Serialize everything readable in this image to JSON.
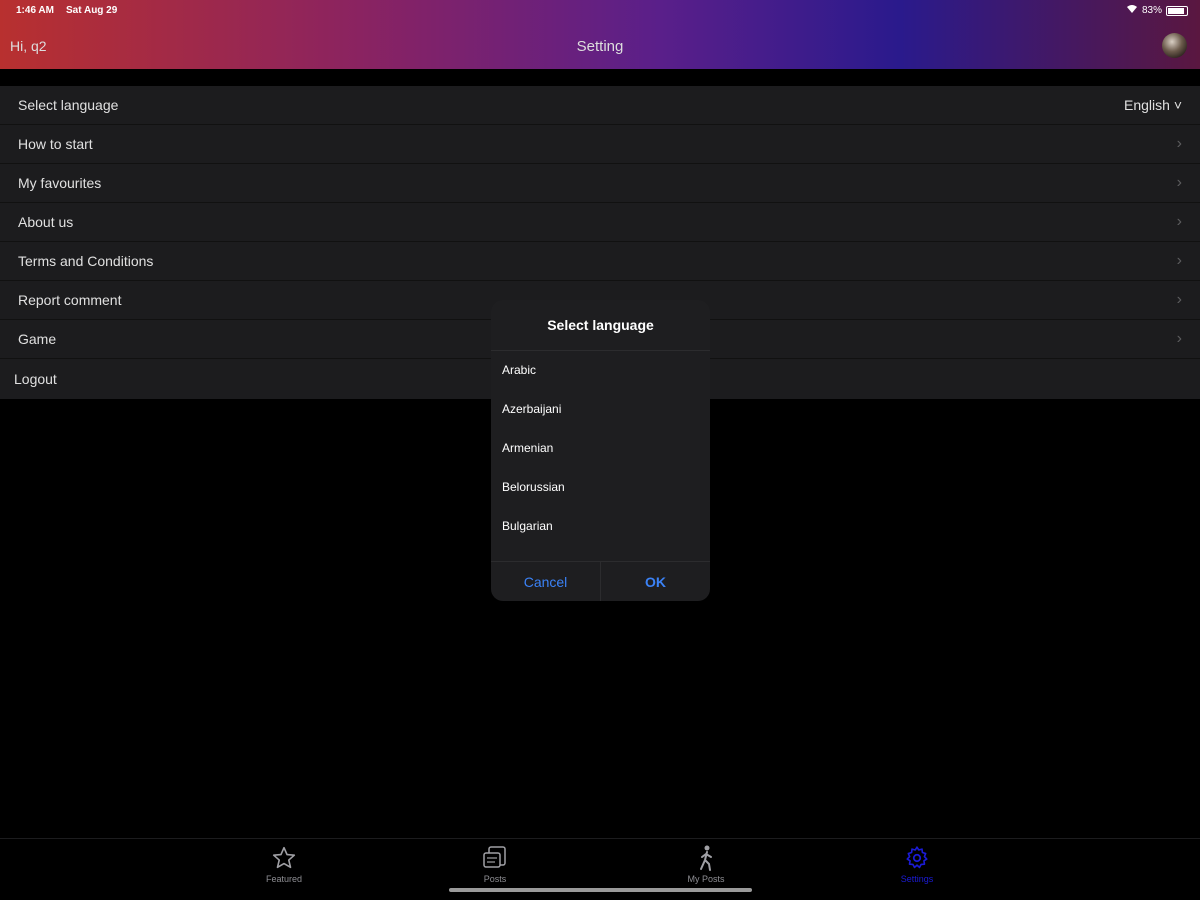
{
  "status": {
    "time": "1:46 AM",
    "date": "Sat Aug 29",
    "battery": "83%"
  },
  "header": {
    "greeting": "Hi, q2",
    "title": "Setting"
  },
  "settings": {
    "rows": [
      {
        "label": "Select language",
        "value": "English ˅"
      },
      {
        "label": "How to start"
      },
      {
        "label": "My favourites"
      },
      {
        "label": "About us"
      },
      {
        "label": "Terms and Conditions"
      },
      {
        "label": "Report comment"
      },
      {
        "label": "Game"
      }
    ],
    "logout": "Logout"
  },
  "dialog": {
    "title": "Select language",
    "options": [
      "Arabic",
      "Azerbaijani",
      "Armenian",
      "Belorussian",
      "Bulgarian"
    ],
    "cancel": "Cancel",
    "ok": "OK"
  },
  "tabs": [
    {
      "label": "Featured",
      "icon": "star-icon"
    },
    {
      "label": "Posts",
      "icon": "posts-icon"
    },
    {
      "label": "My Posts",
      "icon": "walking-person-icon"
    },
    {
      "label": "Settings",
      "icon": "gear-icon",
      "active": true
    }
  ],
  "colors": {
    "accent": "#3b82f6",
    "active_tab": "#1b1bd6",
    "list_bg": "#1c1c1e"
  }
}
